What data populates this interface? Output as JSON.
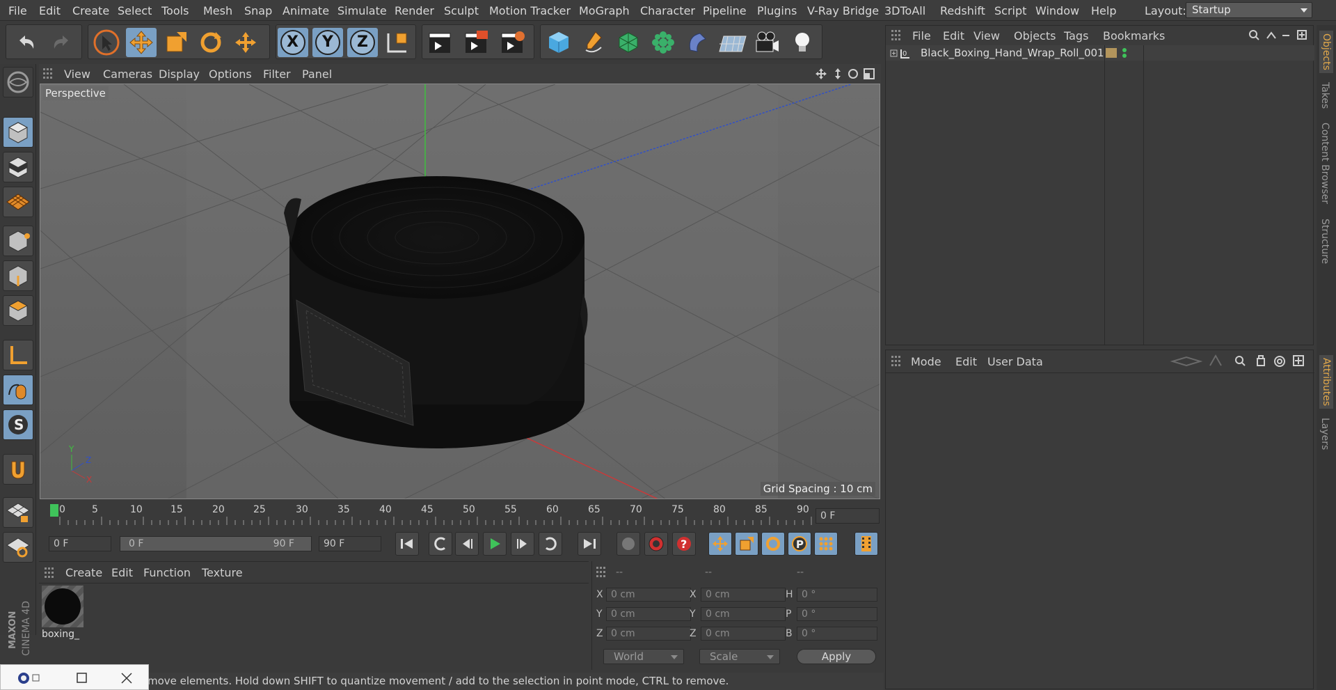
{
  "menubar": {
    "items": [
      "File",
      "Edit",
      "Create",
      "Select",
      "Tools",
      "Mesh",
      "Snap",
      "Animate",
      "Simulate",
      "Render",
      "Sculpt",
      "Motion Tracker",
      "MoGraph",
      "Character",
      "Pipeline",
      "Plugins",
      "V-Ray Bridge",
      "3DToAll",
      "Redshift",
      "Script",
      "Window",
      "Help"
    ],
    "layout_label": "Layout:",
    "layout_value": "Startup"
  },
  "toolbar": {
    "axis_x": "X",
    "axis_y": "Y",
    "axis_z": "Z"
  },
  "viewport": {
    "menus": [
      "View",
      "Cameras",
      "Display",
      "Options",
      "Filter",
      "Panel"
    ],
    "camera_label": "Perspective",
    "grid_spacing": "Grid Spacing : 10 cm"
  },
  "timeline": {
    "ticks": [
      "0",
      "5",
      "10",
      "15",
      "20",
      "25",
      "30",
      "35",
      "40",
      "45",
      "50",
      "55",
      "60",
      "65",
      "70",
      "75",
      "80",
      "85",
      "90"
    ],
    "current_frame": "0 F"
  },
  "transport": {
    "start_frame": "0 F",
    "range_start": "0 F",
    "range_end": "90 F",
    "end_frame": "90 F"
  },
  "material_panel": {
    "menus": [
      "Create",
      "Edit",
      "Function",
      "Texture"
    ],
    "material_name": "boxing_"
  },
  "coord_panel": {
    "headers": [
      "--",
      "--",
      "--"
    ],
    "rows": [
      {
        "l1": "X",
        "v1": "0 cm",
        "l2": "X",
        "v2": "0 cm",
        "l3": "H",
        "v3": "0 °"
      },
      {
        "l1": "Y",
        "v1": "0 cm",
        "l2": "Y",
        "v2": "0 cm",
        "l3": "P",
        "v3": "0 °"
      },
      {
        "l1": "Z",
        "v1": "0 cm",
        "l2": "Z",
        "v2": "0 cm",
        "l3": "B",
        "v3": "0 °"
      }
    ],
    "world_label": "World",
    "scale_label": "Scale",
    "apply_label": "Apply"
  },
  "object_manager": {
    "menus": [
      "File",
      "Edit",
      "View",
      "Objects",
      "Tags",
      "Bookmarks"
    ],
    "object_name": "Black_Boxing_Hand_Wrap_Roll_001"
  },
  "attribute_manager": {
    "menus": [
      "Mode",
      "Edit",
      "User Data"
    ]
  },
  "right_tabs": {
    "top": [
      "Objects",
      "Takes",
      "Content Browser",
      "Structure"
    ],
    "bottom": [
      "Attributes",
      "Layers"
    ]
  },
  "status": {
    "text": "move elements. Hold down SHIFT to quantize movement / add to the selection in point mode, CTRL to remove."
  },
  "brand": {
    "maxon": "MAXON",
    "cinema": "CINEMA 4D"
  },
  "colors": {
    "accent_blue": "#7aa0c4",
    "tab_active": "#e2a84a",
    "play_green": "#3fc35a"
  }
}
